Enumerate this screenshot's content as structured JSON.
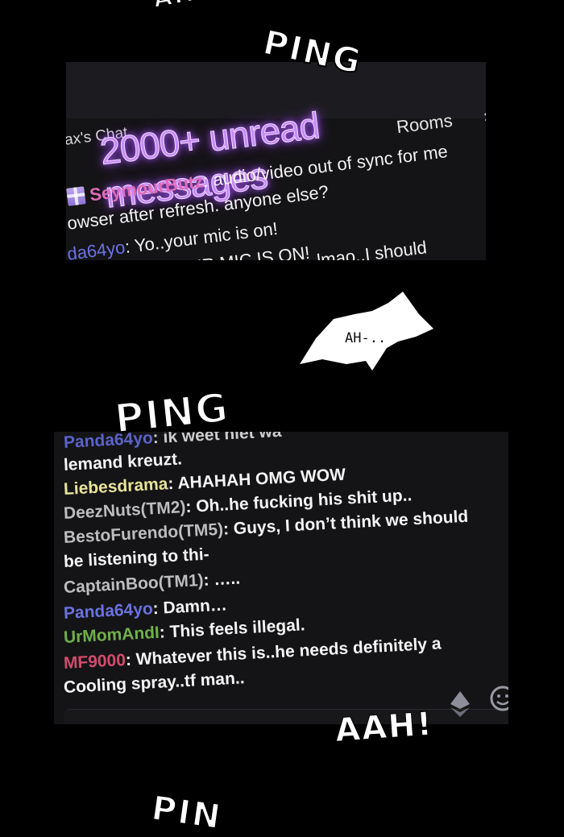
{
  "sfx": {
    "top_cut": "AH",
    "ping_1": "PING",
    "ping_2": "PING",
    "aah": "AAH!",
    "bottom_cut": "PIN"
  },
  "panel_top": {
    "rooms_label": "Rooms",
    "chat_title": "ax's Chat",
    "unread_banner": "2000+ unread messages",
    "lines": [
      {
        "user": "SeymourButz",
        "user_color": "#e06bb8",
        "text": ": audio/video out of sync for me"
      },
      {
        "user": "",
        "user_color": "#ffffff",
        "text": "owser after refresh. anyone else?"
      },
      {
        "user": "da64yo",
        "user_color": "#6b72e8",
        "text": ": Yo..your mic is on!"
      },
      {
        "user": "",
        "user_color": "#ffffff",
        "text": "YOUR MIC IS ON!"
      },
      {
        "user": "",
        "user_color": "#ffffff",
        "text": "lmao..I should"
      }
    ]
  },
  "balloon": {
    "text": "AH-.."
  },
  "panel_bottom": {
    "messages": [
      {
        "user": "Panda64yo",
        "user_color": "#5b63c9",
        "text": ": ik weet niet wa"
      },
      {
        "user": "",
        "user_color": "#ffffff",
        "text": "lemand kreuzt."
      },
      {
        "user": "Liebesdrama",
        "user_color": "#e8e39a",
        "text": ": AHAHAH OMG WOW"
      },
      {
        "user": "DeezNuts(TM2)",
        "user_color": "#bdbdbd",
        "text": ": Oh..he fucking his shit up.."
      },
      {
        "user": "BestoFurendo(TM5)",
        "user_color": "#bdbdbd",
        "text": ": Guys, I don’t think we should"
      },
      {
        "user": "",
        "user_color": "#ffffff",
        "text": "be listening to thi-"
      },
      {
        "user": "CaptainBoo(TM1)",
        "user_color": "#bdbdbd",
        "text": ": ….."
      },
      {
        "user": "Panda64yo",
        "user_color": "#6a72e0",
        "text": ": Damn…"
      },
      {
        "user": "UrMomAndI",
        "user_color": "#6fb04a",
        "text": ": This feels illegal."
      },
      {
        "user": "MF9000",
        "user_color": "#d24c6c",
        "text": ": Whatever this is..he needs definitely a"
      },
      {
        "user": "",
        "user_color": "#ffffff",
        "text": "Cooling spray..tf man.."
      }
    ],
    "icons": [
      "bits-icon",
      "emote-smiley-icon"
    ]
  }
}
